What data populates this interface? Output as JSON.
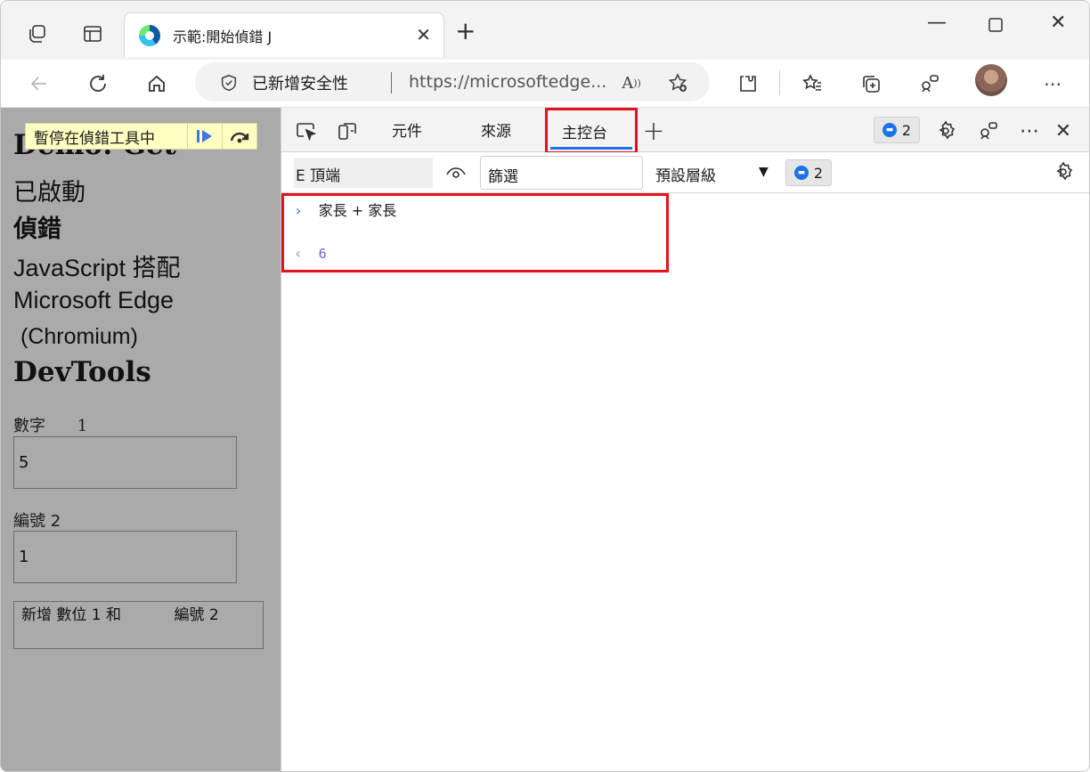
{
  "browser": {
    "tab_title": "示範:開始偵錯 J",
    "security_label": "已新增安全性",
    "url": "https://microsoftedge...",
    "nav": {
      "back": "back-arrow",
      "refresh": "refresh",
      "home": "home"
    }
  },
  "page": {
    "paused_label": "暫停在偵錯工具中",
    "headings": {
      "h1": "Demo: Get",
      "h2": "已啟動",
      "h3": "偵錯",
      "h4": "JavaScript 搭配",
      "h5": "Microsoft Edge",
      "h6": "(Chromium)",
      "h7": "DevTools"
    },
    "field1": {
      "label": "數字",
      "label_num": "1",
      "value": "5"
    },
    "field2": {
      "label": "編號 2",
      "value": "1"
    },
    "button_label": "新增 數位 1 和",
    "button_label_2": "編號 2"
  },
  "devtools": {
    "tabs": [
      "元件",
      "來源",
      "主控台"
    ],
    "active_tab": "主控台",
    "issues_count": "2",
    "context_select": "E 頂端",
    "filter_value": "篩選",
    "level_select": "預設層級",
    "toolbar_issues_count": "2",
    "console": {
      "command": "家長 + 家長",
      "result": "6"
    }
  },
  "colors": {
    "highlight_red": "#e8101a",
    "accent_blue": "#1a73e8",
    "paused_yellow": "#ffffc2",
    "page_gray": "#aaaaaa"
  }
}
